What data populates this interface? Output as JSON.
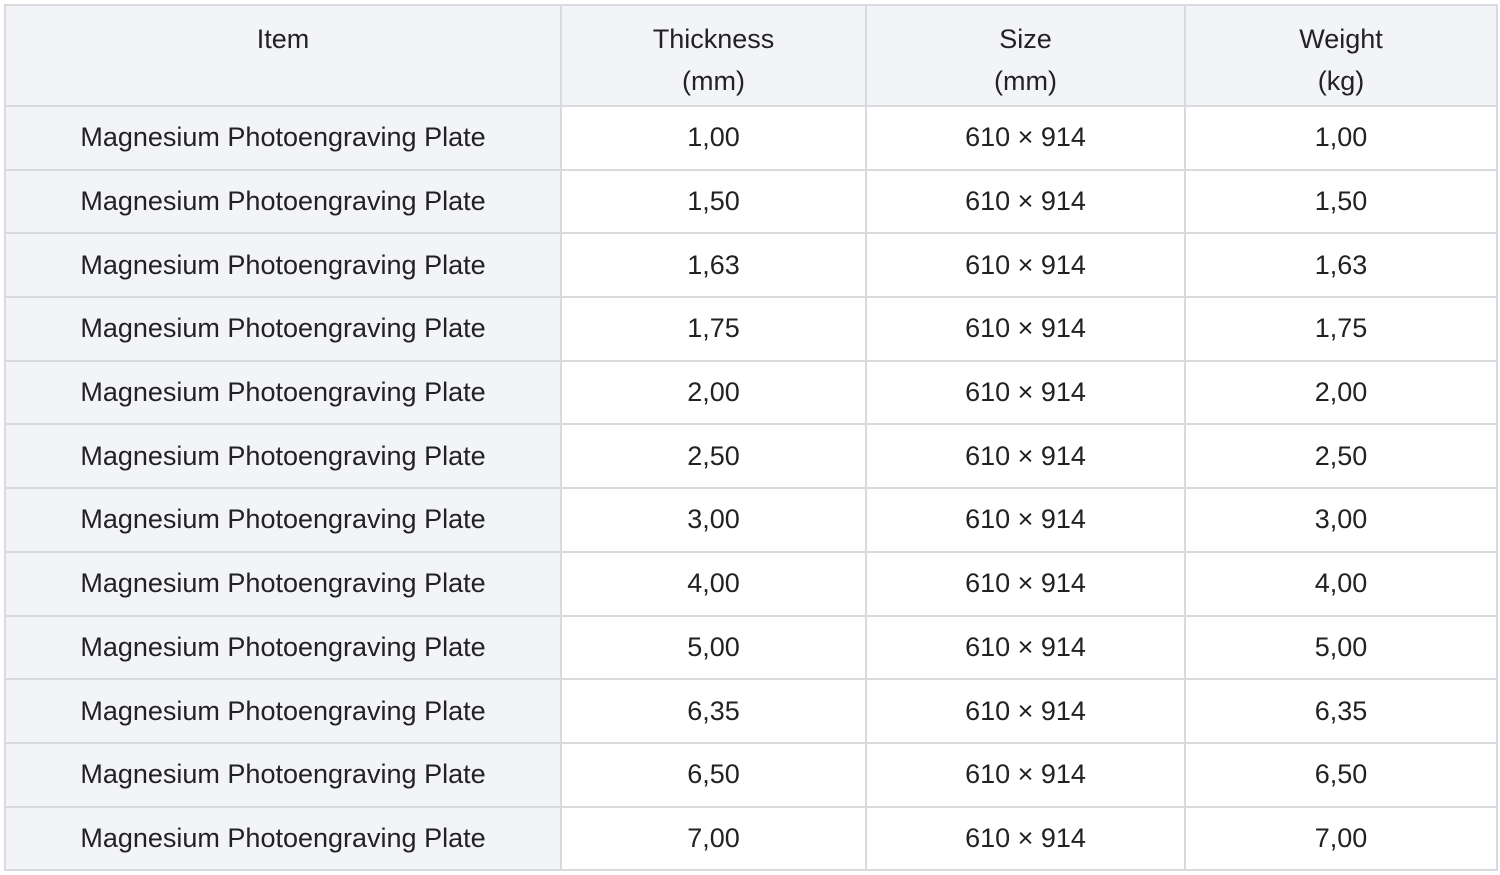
{
  "table": {
    "headers": [
      {
        "line1": "Item",
        "line2": ""
      },
      {
        "line1": "Thickness",
        "line2": "(mm)"
      },
      {
        "line1": "Size",
        "line2": "(mm)"
      },
      {
        "line1": "Weight",
        "line2": "(kg)"
      }
    ],
    "rows": [
      {
        "item": "Magnesium Photoengraving Plate",
        "thickness": "1,00",
        "size": "610 × 914",
        "weight": "1,00"
      },
      {
        "item": "Magnesium Photoengraving Plate",
        "thickness": "1,50",
        "size": "610 × 914",
        "weight": "1,50"
      },
      {
        "item": "Magnesium Photoengraving Plate",
        "thickness": "1,63",
        "size": "610 × 914",
        "weight": "1,63"
      },
      {
        "item": "Magnesium Photoengraving Plate",
        "thickness": "1,75",
        "size": "610 × 914",
        "weight": "1,75"
      },
      {
        "item": "Magnesium Photoengraving Plate",
        "thickness": "2,00",
        "size": "610 × 914",
        "weight": "2,00"
      },
      {
        "item": "Magnesium Photoengraving Plate",
        "thickness": "2,50",
        "size": "610 × 914",
        "weight": "2,50"
      },
      {
        "item": "Magnesium Photoengraving Plate",
        "thickness": "3,00",
        "size": "610 × 914",
        "weight": "3,00"
      },
      {
        "item": "Magnesium Photoengraving Plate",
        "thickness": "4,00",
        "size": "610 × 914",
        "weight": "4,00"
      },
      {
        "item": "Magnesium Photoengraving Plate",
        "thickness": "5,00",
        "size": "610 × 914",
        "weight": "5,00"
      },
      {
        "item": "Magnesium Photoengraving Plate",
        "thickness": "6,35",
        "size": "610 × 914",
        "weight": "6,35"
      },
      {
        "item": "Magnesium Photoengraving Plate",
        "thickness": "6,50",
        "size": "610 × 914",
        "weight": "6,50"
      },
      {
        "item": "Magnesium Photoengraving Plate",
        "thickness": "7,00",
        "size": "610 × 914",
        "weight": "7,00"
      }
    ]
  },
  "colors": {
    "header_bg": "#f3f4f7",
    "first_column_bg": "#f3f4f7",
    "border": "#d9dade",
    "text": "#222222"
  }
}
